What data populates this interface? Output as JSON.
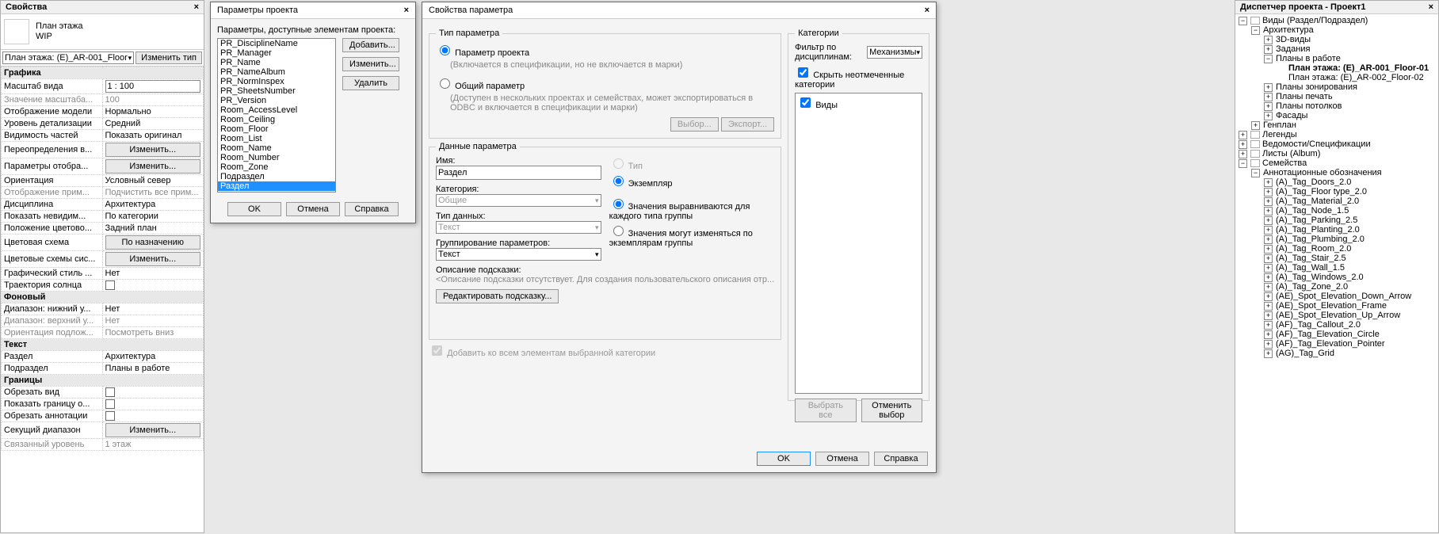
{
  "properties_panel": {
    "title": "Свойства",
    "type_line1": "План этажа",
    "type_line2": "WIP",
    "instance_label": "План этажа: (E)_AR-001_Floor",
    "edit_type": "Изменить тип",
    "sections": {
      "graphics": "Графика",
      "scale": {
        "label": "Масштаб вида",
        "value": "1 : 100"
      },
      "scale_value": {
        "label": "Значение масштаба...",
        "value": "100"
      },
      "display_model": {
        "label": "Отображение модели",
        "value": "Нормально"
      },
      "detail": {
        "label": "Уровень детализации",
        "value": "Средний"
      },
      "vis": {
        "label": "Видимость частей",
        "value": "Показать оригинал"
      },
      "overrides": {
        "label": "Переопределения в...",
        "value": "Изменить..."
      },
      "disp_params": {
        "label": "Параметры отобра...",
        "value": "Изменить..."
      },
      "orient": {
        "label": "Ориентация",
        "value": "Условный север"
      },
      "note_disp": {
        "label": "Отображение прим...",
        "value": "Подчистить все прим..."
      },
      "discipline": {
        "label": "Дисциплина",
        "value": "Архитектура"
      },
      "show_hidden": {
        "label": "Показать невидим...",
        "value": "По категории"
      },
      "color_loc": {
        "label": "Положение цветово...",
        "value": "Задний план"
      },
      "color_scheme": {
        "label": "Цветовая схема",
        "value": "По назначению"
      },
      "sys_color": {
        "label": "Цветовые схемы сис...",
        "value": "Изменить..."
      },
      "gfx_style": {
        "label": "Графический стиль ...",
        "value": "Нет"
      },
      "sun": {
        "label": "Траектория солнца",
        "value": ""
      },
      "bg": "Фоновый",
      "range_bot": {
        "label": "Диапазон: нижний у...",
        "value": "Нет"
      },
      "range_top": {
        "label": "Диапазон: верхний у...",
        "value": "Нет"
      },
      "under_orient": {
        "label": "Ориентация подлож...",
        "value": "Посмотреть вниз"
      },
      "text": "Текст",
      "section_field": {
        "label": "Раздел",
        "value": "Архитектура"
      },
      "subsection_field": {
        "label": "Подраздел",
        "value": "Планы в работе"
      },
      "bounds": "Границы",
      "crop_view": {
        "label": "Обрезать вид"
      },
      "show_crop": {
        "label": "Показать границу о..."
      },
      "crop_anno": {
        "label": "Обрезать аннотации"
      },
      "scope_box": {
        "label": "Секущий диапазон",
        "value": "Изменить..."
      },
      "assoc_level": {
        "label": "Связанный уровень",
        "value": "1 этаж"
      }
    }
  },
  "project_params_dialog": {
    "title": "Параметры проекта",
    "available_label": "Параметры, доступные элементам проекта:",
    "list": [
      "PR_DisciplineName",
      "PR_Manager",
      "PR_Name",
      "PR_NameAlbum",
      "PR_NormInspex",
      "PR_SheetsNumber",
      "PR_Version",
      "Room_AccessLevel",
      "Room_Ceiling",
      "Room_Floor",
      "Room_List",
      "Room_Name",
      "Room_Number",
      "Room_Zone",
      "Подраздел",
      "Раздел"
    ],
    "selected": "Раздел",
    "btn_add": "Добавить...",
    "btn_edit": "Изменить...",
    "btn_delete": "Удалить",
    "btn_ok": "OK",
    "btn_cancel": "Отмена",
    "btn_help": "Справка"
  },
  "param_props_dialog": {
    "title": "Свойства параметра",
    "type_group": "Тип параметра",
    "radio_project": "Параметр проекта",
    "radio_project_note": "(Включается в спецификации, но не включается в марки)",
    "radio_shared": "Общий параметр",
    "radio_shared_note": "(Доступен в нескольких проектах и семействах, может экспортироваться в ODBC и включается в спецификации и марки)",
    "btn_select": "Выбор...",
    "btn_export": "Экспорт...",
    "data_group": "Данные параметра",
    "name_label": "Имя:",
    "name_value": "Раздел",
    "category_label": "Категория:",
    "category_value": "Общие",
    "datatype_label": "Тип данных:",
    "datatype_value": "Текст",
    "grouping_label": "Группирование параметров:",
    "grouping_value": "Текст",
    "tooltip_label": "Описание подсказки:",
    "tooltip_note": "<Описание подсказки отсутствует. Для создания пользовательского описания отр...",
    "btn_edit_tooltip": "Редактировать подсказку...",
    "radio_type": "Тип",
    "radio_instance": "Экземпляр",
    "radio_align": "Значения выравниваются для каждого типа группы",
    "radio_vary": "Значения могут изменяться по экземплярам группы",
    "chk_addall": "Добавить ко всем элементам выбранной категории",
    "btn_ok": "OK",
    "btn_cancel": "Отмена",
    "btn_help": "Справка",
    "categories_group": "Категории",
    "filter_label": "Фильтр по дисциплинам:",
    "filter_value": "Механизмы",
    "hide_unchecked": "Скрыть неотмеченные категории",
    "cat_views": "Виды",
    "btn_checkall": "Выбрать все",
    "btn_uncheckall": "Отменить выбор"
  },
  "browser_panel": {
    "title": "Диспетчер проекта - Проект1",
    "views_root": "Виды (Раздел/Подраздел)",
    "arch": "Архитектура",
    "3d": "3D-виды",
    "tasks": "Задания",
    "plans_work": "Планы в работе",
    "plan1": "План этажа: (E)_AR-001_Floor-01",
    "plan2": "План этажа: (E)_AR-002_Floor-02",
    "zoning": "Планы зонирования",
    "print": "Планы печать",
    "ceiling": "Планы потолков",
    "facades": "Фасады",
    "genplan": "Генплан",
    "legends": "Легенды",
    "schedules": "Ведомости/Спецификации",
    "sheets": "Листы (Album)",
    "families": "Семейства",
    "anno": "Аннотационные обозначения",
    "fam_items": [
      "(A)_Tag_Doors_2.0",
      "(A)_Tag_Floor type_2.0",
      "(A)_Tag_Material_2.0",
      "(A)_Tag_Node_1.5",
      "(A)_Tag_Parking_2.5",
      "(A)_Tag_Planting_2.0",
      "(A)_Tag_Plumbing_2.0",
      "(A)_Tag_Room_2.0",
      "(A)_Tag_Stair_2.5",
      "(A)_Tag_Wall_1.5",
      "(A)_Tag_Windows_2.0",
      "(A)_Tag_Zone_2.0",
      "(AE)_Spot_Elevation_Down_Arrow",
      "(AE)_Spot_Elevation_Frame",
      "(AE)_Spot_Elevation_Up_Arrow",
      "(AF)_Tag_Callout_2.0",
      "(AF)_Tag_Elevation_Circle",
      "(AF)_Tag_Elevation_Pointer",
      "(AG)_Tag_Grid"
    ]
  }
}
